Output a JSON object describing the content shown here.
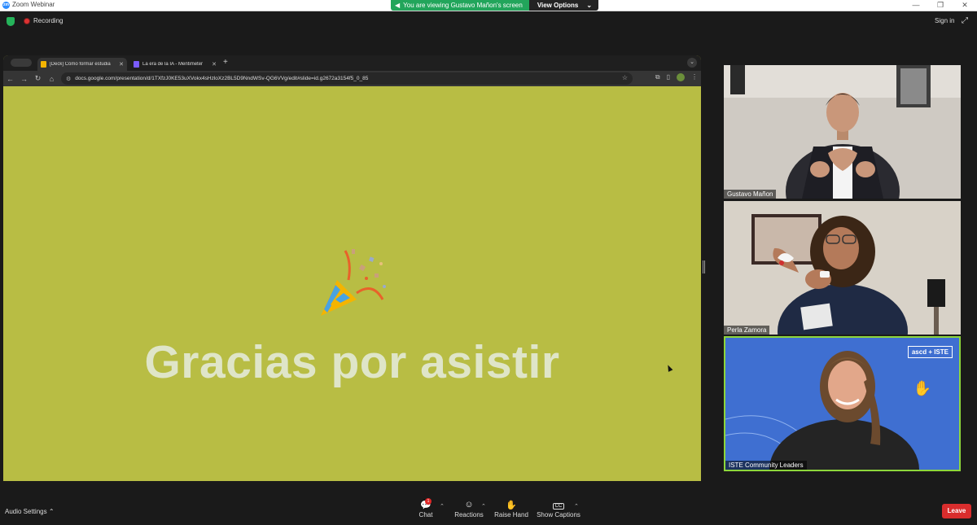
{
  "window": {
    "title": "Zoom Webinar",
    "logo_text": "zm",
    "controls": [
      "—",
      "❐",
      "✕"
    ]
  },
  "share_banner": {
    "text": "You are viewing Gustavo Mañon's screen",
    "view_options": "View Options"
  },
  "topbar": {
    "recording": "Recording",
    "sign_in": "Sign in"
  },
  "browser": {
    "tabs": [
      {
        "title": "[Deck] Cómo formar estudia",
        "close": "✕"
      },
      {
        "title": "La era de la IA - Mentimeter",
        "close": "✕"
      }
    ],
    "new_tab": "+",
    "url": "docs.google.com/presentation/d/1TXfzJ0KE53uXVokx4sHzloXz2BL5D9NndWSv-QG6VVg/edit#slide=id.g2672a3154f5_0_85"
  },
  "slide": {
    "title": "Gracias por asistir",
    "background_color": "#b8bd44"
  },
  "participants": [
    {
      "name": "Gustavo Mañon"
    },
    {
      "name": "Perla Zamora"
    },
    {
      "name": "ISTE Community Leaders",
      "logo_text": "ascd + ISTE"
    }
  ],
  "bottombar": {
    "audio_settings": "Audio Settings",
    "chat": "Chat",
    "chat_badge": "1",
    "reactions": "Reactions",
    "raise_hand": "Raise Hand",
    "show_captions": "Show Captions",
    "captions_icon": "CC",
    "leave": "Leave"
  },
  "colors": {
    "accent_green": "#22a55b",
    "leave_red": "#d92d2d",
    "active_speaker_border": "#8dd63b"
  }
}
